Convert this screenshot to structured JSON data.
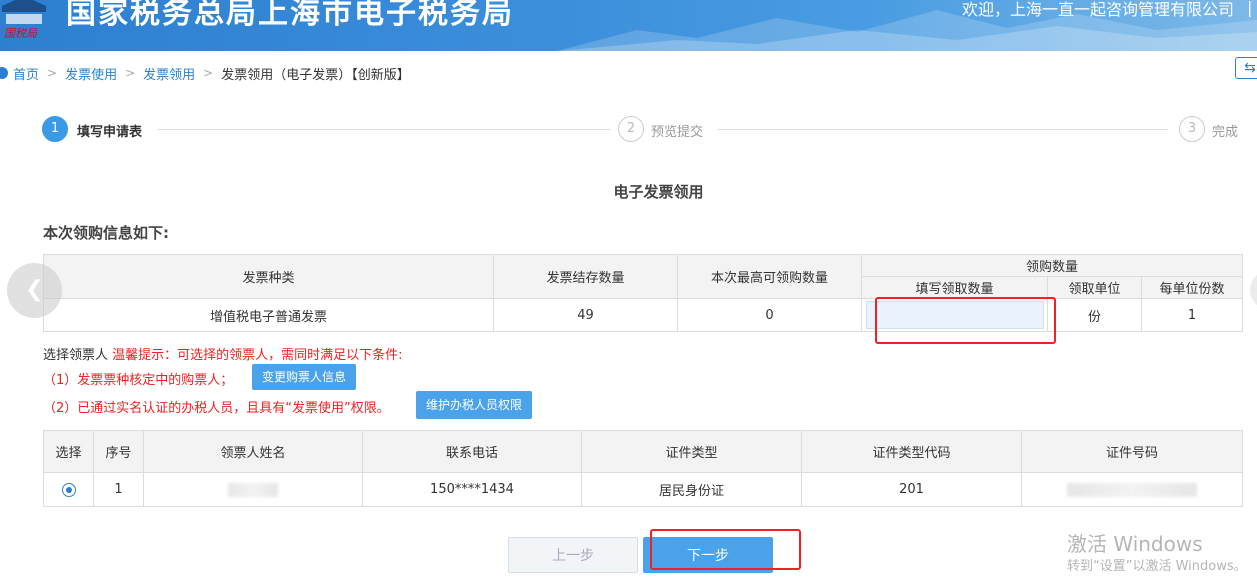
{
  "header": {
    "title": "国家税务总局上海市电子税务局",
    "welcome": "欢迎，上海一直一起咨询管理有限公司",
    "separator": "|",
    "logo_text": "国税"
  },
  "breadcrumb": {
    "home": "首页",
    "items": [
      "发票使用",
      "发票领用"
    ],
    "current": "发票领用（电子发票）【创新版】",
    "back_icon": "⇆"
  },
  "steps": [
    {
      "num": "1",
      "label": "填写申请表",
      "active": true
    },
    {
      "num": "2",
      "label": "预览提交",
      "active": false
    },
    {
      "num": "3",
      "label": "完成",
      "active": false
    }
  ],
  "form_title": "电子发票领用",
  "section_title": "本次领购信息如下:",
  "invoice_table": {
    "headers": {
      "type": "发票种类",
      "stock": "发票结存数量",
      "max": "本次最高可领购数量",
      "quantity_group": "领购数量",
      "fill": "填写领取数量",
      "unit": "领取单位",
      "per_unit": "每单位份数"
    },
    "row": {
      "type": "增值税电子普通发票",
      "stock": "49",
      "max": "0",
      "fill_value": "",
      "unit": "份",
      "per_unit": "1"
    }
  },
  "tips": {
    "prefix": "选择领票人",
    "warm": "温馨提示：可选择的领票人，需同时满足以下条件:",
    "cond1": "（1）发票票种核定中的购票人；",
    "cond1_button": "变更购票人信息",
    "cond2": "（2）已通过实名认证的办税人员，且具有“发票使用”权限。",
    "cond2_button": "维护办税人员权限"
  },
  "person_table": {
    "headers": [
      "选择",
      "序号",
      "领票人姓名",
      "联系电话",
      "证件类型",
      "证件类型代码",
      "证件号码"
    ],
    "rows": [
      {
        "selected": true,
        "index": "1",
        "name": "",
        "phone": "150****1434",
        "id_type": "居民身份证",
        "id_type_code": "201",
        "id_number": ""
      }
    ]
  },
  "buttons": {
    "prev": "上一步",
    "next": "下一步"
  },
  "watermark": {
    "title": "激活 Windows",
    "sub": "转到“设置”以激活 Windows。"
  },
  "colors": {
    "accent": "#2c7fd0",
    "button": "#4aa3ea",
    "warning": "#e22222"
  }
}
